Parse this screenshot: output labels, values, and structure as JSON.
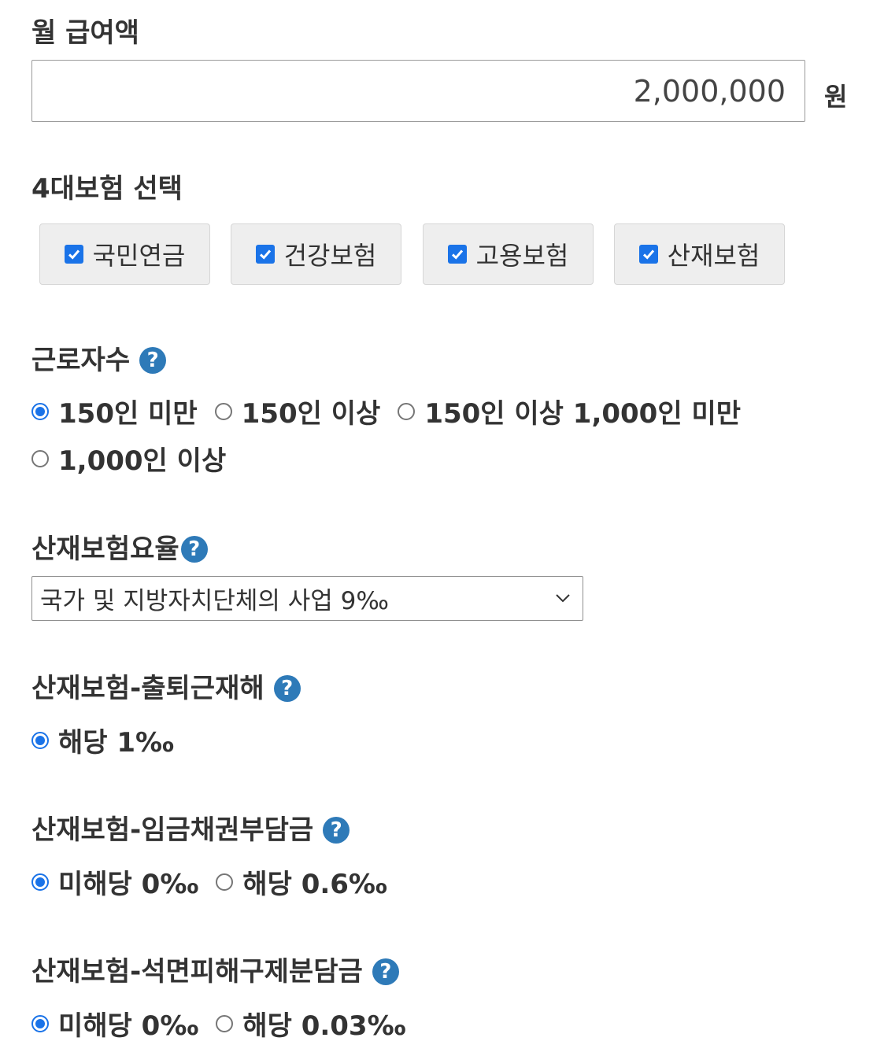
{
  "salary": {
    "label": "월 급여액",
    "value": "2,000,000",
    "unit": "원"
  },
  "insurance": {
    "label": "4대보험 선택",
    "options": [
      {
        "label": "국민연금",
        "checked": true
      },
      {
        "label": "건강보험",
        "checked": true
      },
      {
        "label": "고용보험",
        "checked": true
      },
      {
        "label": "산재보험",
        "checked": true
      }
    ]
  },
  "workers": {
    "label": "근로자수",
    "help": "?",
    "options": [
      {
        "label": "150인 미만",
        "selected": true
      },
      {
        "label": "150인 이상",
        "selected": false
      },
      {
        "label": "150인 이상 1,000인 미만",
        "selected": false
      },
      {
        "label": "1,000인 이상",
        "selected": false
      }
    ]
  },
  "industrial_rate": {
    "label": "산재보험요율",
    "help": "?",
    "selected": "국가 및 지방자치단체의 사업 9‰"
  },
  "commute": {
    "label": "산재보험-출퇴근재해",
    "help": "?",
    "options": [
      {
        "label": "해당 1‰",
        "selected": true
      }
    ]
  },
  "wage_claim": {
    "label": "산재보험-임금채권부담금",
    "help": "?",
    "options": [
      {
        "label": "미해당 0‰",
        "selected": true
      },
      {
        "label": "해당 0.6‰",
        "selected": false
      }
    ]
  },
  "asbestos": {
    "label": "산재보험-석면피해구제분담금",
    "help": "?",
    "options": [
      {
        "label": "미해당 0‰",
        "selected": true
      },
      {
        "label": "해당 0.03‰",
        "selected": false
      }
    ]
  },
  "colors": {
    "accent": "#1a73e8",
    "help_icon": "#2e7ab8",
    "box_bg": "#eeeeee"
  }
}
